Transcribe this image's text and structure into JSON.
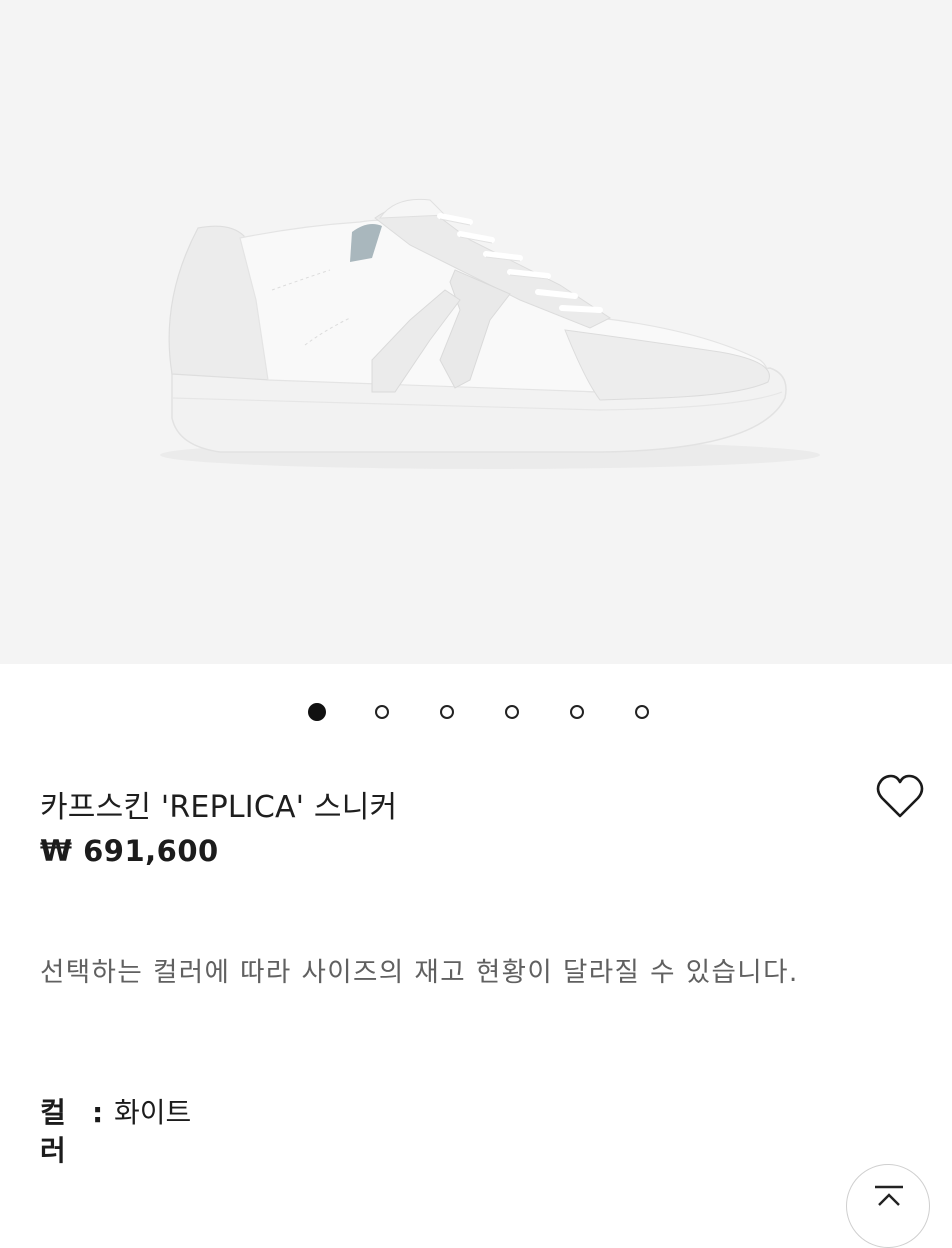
{
  "gallery": {
    "image_alt": "white leather sneaker with light grey suede panels",
    "dots": [
      {
        "active": true
      },
      {
        "active": false
      },
      {
        "active": false
      },
      {
        "active": false
      },
      {
        "active": false
      },
      {
        "active": false
      }
    ]
  },
  "product": {
    "title": "카프스킨 'REPLICA' 스니커",
    "price": "₩ 691,600",
    "wishlist_icon": "heart-outline-icon"
  },
  "notice": "선택하는 컬러에 따라 사이즈의 재고 현황이 달라질 수 있습니다.",
  "options": {
    "color_label": "컬러",
    "color_separator": ":",
    "color_value": "화이트"
  },
  "scroll_top_icon": "arrow-up-icon",
  "colors": {
    "hero_bg": "#f4f4f4",
    "text": "#1e1e1e",
    "muted": "#606060"
  }
}
